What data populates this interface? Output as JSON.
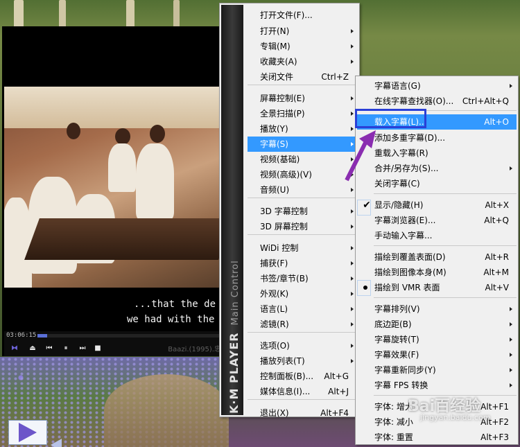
{
  "player": {
    "time": "03:06:15",
    "filename": "Baazi.(1995).忠",
    "progress": 0.05,
    "subtitle_line1": "...that the de",
    "subtitle_line2": "we had with the",
    "controls": [
      "prev-icon",
      "eject-icon",
      "skip-back-icon",
      "pause-icon",
      "skip-forward-icon",
      "stop-icon"
    ]
  },
  "sidebar_brand": {
    "title": "K·M PLAYER",
    "subtitle": "Main Control"
  },
  "main_menu": {
    "items": [
      {
        "label": "打开文件(F)...",
        "shortcut": "",
        "arrow": false
      },
      {
        "label": "打开(N)",
        "shortcut": "",
        "arrow": true
      },
      {
        "label": "专辑(M)",
        "shortcut": "",
        "arrow": true
      },
      {
        "label": "收藏夹(A)",
        "shortcut": "",
        "arrow": true
      },
      {
        "label": "关闭文件",
        "shortcut": "Ctrl+Z",
        "arrow": false
      },
      {
        "label": "屏幕控制(E)",
        "shortcut": "",
        "arrow": true
      },
      {
        "label": "全景扫描(P)",
        "shortcut": "",
        "arrow": true
      },
      {
        "label": "播放(Y)",
        "shortcut": "",
        "arrow": true
      },
      {
        "label": "字幕(S)",
        "shortcut": "",
        "arrow": true
      },
      {
        "label": "视频(基础)",
        "shortcut": "",
        "arrow": true
      },
      {
        "label": "视频(高级)(V)",
        "shortcut": "",
        "arrow": true
      },
      {
        "label": "音频(U)",
        "shortcut": "",
        "arrow": true
      },
      {
        "label": "3D 字幕控制",
        "shortcut": "",
        "arrow": true
      },
      {
        "label": "3D 屏幕控制",
        "shortcut": "",
        "arrow": true
      },
      {
        "label": "WiDi 控制",
        "shortcut": "",
        "arrow": true
      },
      {
        "label": "捕获(F)",
        "shortcut": "",
        "arrow": true
      },
      {
        "label": "书签/章节(B)",
        "shortcut": "",
        "arrow": true
      },
      {
        "label": "外观(K)",
        "shortcut": "",
        "arrow": true
      },
      {
        "label": "语言(L)",
        "shortcut": "",
        "arrow": true
      },
      {
        "label": "滤镜(R)",
        "shortcut": "",
        "arrow": true
      },
      {
        "label": "选项(O)",
        "shortcut": "",
        "arrow": true
      },
      {
        "label": "播放列表(T)",
        "shortcut": "",
        "arrow": true
      },
      {
        "label": "控制面板(B)...",
        "shortcut": "Alt+G",
        "arrow": false
      },
      {
        "label": "媒体信息(I)...",
        "shortcut": "Alt+J",
        "arrow": false
      },
      {
        "label": "退出(X)",
        "shortcut": "Alt+F4",
        "arrow": false
      }
    ]
  },
  "subtitle_menu": {
    "items": [
      {
        "label": "字幕语言(G)",
        "shortcut": "",
        "arrow": true,
        "mark": ""
      },
      {
        "label": "在线字幕查找器(O)...",
        "shortcut": "Ctrl+Alt+Q",
        "arrow": false,
        "mark": ""
      },
      {
        "label": "载入字幕(L)...",
        "shortcut": "Alt+O",
        "arrow": false,
        "mark": ""
      },
      {
        "label": "添加多重字幕(D)...",
        "shortcut": "",
        "arrow": false,
        "mark": ""
      },
      {
        "label": "重载入字幕(R)",
        "shortcut": "",
        "arrow": false,
        "mark": ""
      },
      {
        "label": "合并/另存为(S)...",
        "shortcut": "",
        "arrow": true,
        "mark": ""
      },
      {
        "label": "关闭字幕(C)",
        "shortcut": "",
        "arrow": false,
        "mark": ""
      },
      {
        "label": "显示/隐藏(H)",
        "shortcut": "Alt+X",
        "arrow": false,
        "mark": "check"
      },
      {
        "label": "字幕浏览器(E)...",
        "shortcut": "Alt+Q",
        "arrow": false,
        "mark": ""
      },
      {
        "label": "手动输入字幕...",
        "shortcut": "",
        "arrow": false,
        "mark": ""
      },
      {
        "label": "描绘到覆盖表面(D)",
        "shortcut": "Alt+R",
        "arrow": false,
        "mark": ""
      },
      {
        "label": "描绘到图像本身(M)",
        "shortcut": "Alt+M",
        "arrow": false,
        "mark": ""
      },
      {
        "label": "描绘到 VMR 表面",
        "shortcut": "Alt+V",
        "arrow": false,
        "mark": "dot"
      },
      {
        "label": "字幕排列(V)",
        "shortcut": "",
        "arrow": true,
        "mark": ""
      },
      {
        "label": "底边距(B)",
        "shortcut": "",
        "arrow": true,
        "mark": ""
      },
      {
        "label": "字幕旋转(T)",
        "shortcut": "",
        "arrow": true,
        "mark": ""
      },
      {
        "label": "字幕效果(F)",
        "shortcut": "",
        "arrow": true,
        "mark": ""
      },
      {
        "label": "字幕重新同步(Y)",
        "shortcut": "",
        "arrow": true,
        "mark": ""
      },
      {
        "label": "字幕 FPS 转换",
        "shortcut": "",
        "arrow": true,
        "mark": ""
      },
      {
        "label": "字体: 增大",
        "shortcut": "Alt+F1",
        "arrow": false,
        "mark": ""
      },
      {
        "label": "字体: 减小",
        "shortcut": "Alt+F2",
        "arrow": false,
        "mark": ""
      },
      {
        "label": "字体: 重置",
        "shortcut": "Alt+F3",
        "arrow": false,
        "mark": ""
      }
    ]
  },
  "watermark": {
    "brand": "Bai百经验",
    "url": "jingyan.baidu.com"
  },
  "colors": {
    "highlight": "#3399ff",
    "annotation": "#2a3fd6",
    "arrow": "#8a2db0"
  }
}
